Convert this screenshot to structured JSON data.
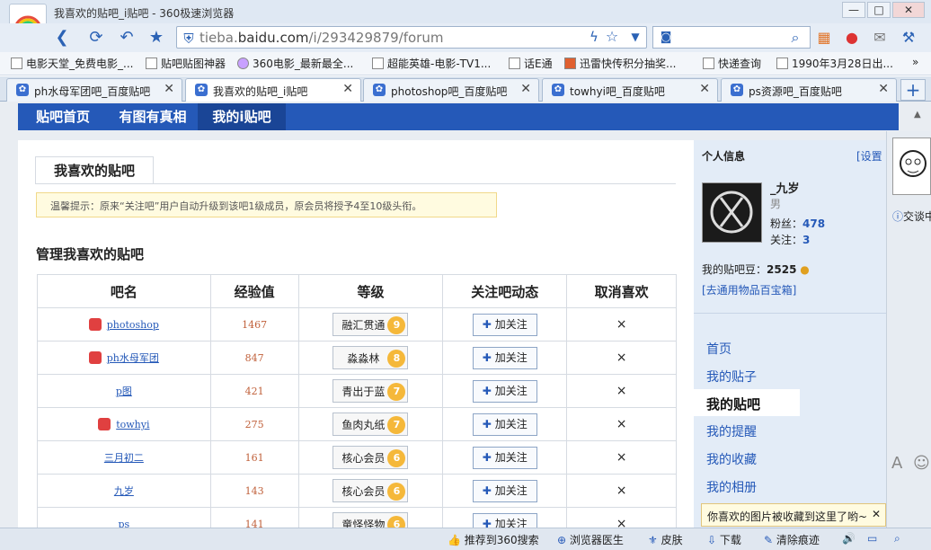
{
  "window": {
    "title": "我喜欢的贴吧_i贴吧 - 360极速浏览器"
  },
  "address": {
    "prefix": "tieba.",
    "domain": "baidu.com",
    "path": "/i/293429879/forum"
  },
  "bookmarks": [
    "电影天堂_免费电影_...",
    "贴吧贴图神器",
    "360电影_最新最全...",
    "超能英雄-电影-TV1...",
    "话E通",
    "迅雷快传积分抽奖...",
    "快递查询",
    "1990年3月28日出..."
  ],
  "tabs": [
    {
      "label": "ph水母军团吧_百度贴吧",
      "active": false
    },
    {
      "label": "我喜欢的贴吧_i贴吧",
      "active": true
    },
    {
      "label": "photoshop吧_百度贴吧",
      "active": false
    },
    {
      "label": "towhyi吧_百度贴吧",
      "active": false
    },
    {
      "label": "ps资源吧_百度贴吧",
      "active": false
    }
  ],
  "tieba_nav": [
    {
      "label": "贴吧首页"
    },
    {
      "label": "有图有真相"
    },
    {
      "label": "我的i贴吧"
    }
  ],
  "page": {
    "tab_title": "我喜欢的贴吧",
    "tip": "温馨提示：原来“关注吧”用户自动升级到该吧1级成员，原会员将授予4至10级头衔。",
    "section_title": "管理我喜欢的贴吧",
    "columns": [
      "吧名",
      "经验值",
      "等级",
      "关注吧动态",
      "取消喜欢"
    ],
    "follow_label": "加关注",
    "unlike_symbol": "×",
    "rows": [
      {
        "name": "photoshop",
        "icon": true,
        "exp": "1467",
        "level_name": "融汇贯通",
        "level": "9"
      },
      {
        "name": "ph水母军团",
        "icon": true,
        "exp": "847",
        "level_name": "淼淼林",
        "level": "8"
      },
      {
        "name": "p图",
        "icon": false,
        "exp": "421",
        "level_name": "青出于蓝",
        "level": "7"
      },
      {
        "name": "towhyi",
        "icon": true,
        "exp": "275",
        "level_name": "鱼肉丸纸",
        "level": "7"
      },
      {
        "name": "三月初二",
        "icon": false,
        "exp": "161",
        "level_name": "核心会员",
        "level": "6"
      },
      {
        "name": "九岁",
        "icon": false,
        "exp": "143",
        "level_name": "核心会员",
        "level": "6"
      },
      {
        "name": "ps",
        "icon": false,
        "exp": "141",
        "level_name": "童怪怪物",
        "level": "6"
      }
    ]
  },
  "sidebar": {
    "title": "个人信息",
    "settings": "[设置",
    "username": "_九岁",
    "gender": "男",
    "fans_label": "粉丝：",
    "fans": "478",
    "follow_label": "关注：",
    "follow": "3",
    "beans_label": "我的贴吧豆：",
    "beans": "2525",
    "treasure_link": "[去通用物品百宝箱]",
    "nav": [
      "首页",
      "我的贴子",
      "我的贴吧",
      "我的提醒",
      "我的收藏",
      "我的相册"
    ],
    "toast": "你喜欢的图片被收藏到这里了哟~"
  },
  "chat": {
    "label": "交谈中"
  },
  "statusbar": [
    "推荐到360搜索",
    "浏览器医生",
    "皮肤",
    "下载",
    "清除痕迹"
  ]
}
